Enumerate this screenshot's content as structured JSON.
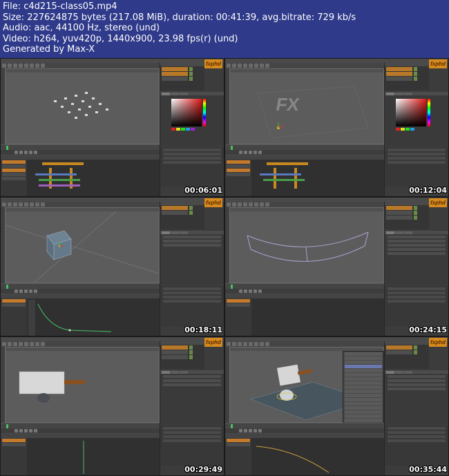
{
  "header": {
    "file_line": "File: c4d215-class05.mp4",
    "size_line": "Size: 227624875 bytes (217.08 MiB), duration: 00:41:39, avg.bitrate: 729 kb/s",
    "audio_line": "Audio: aac, 44100 Hz, stereo (und)",
    "video_line": "Video: h264, yuv420p, 1440x900, 23.98 fps(r) (und)",
    "generator_line": "Generated by Max-X"
  },
  "thumbnails": [
    {
      "timestamp": "00:06:01",
      "scene": "cloner-grid"
    },
    {
      "timestamp": "00:12:04",
      "scene": "text-grid"
    },
    {
      "timestamp": "00:18:11",
      "scene": "cube"
    },
    {
      "timestamp": "00:24:15",
      "scene": "bent-plane"
    },
    {
      "timestamp": "00:29:49",
      "scene": "knife-sphere"
    },
    {
      "timestamp": "00:35:44",
      "scene": "knife-floor-menu"
    }
  ],
  "logo_text": "fxphd",
  "colors": {
    "header_bg": "#2f3a8a",
    "ui_dark": "#3a3a3a",
    "accent_orange": "#d68a1e",
    "timeline_green": "#48c060"
  }
}
